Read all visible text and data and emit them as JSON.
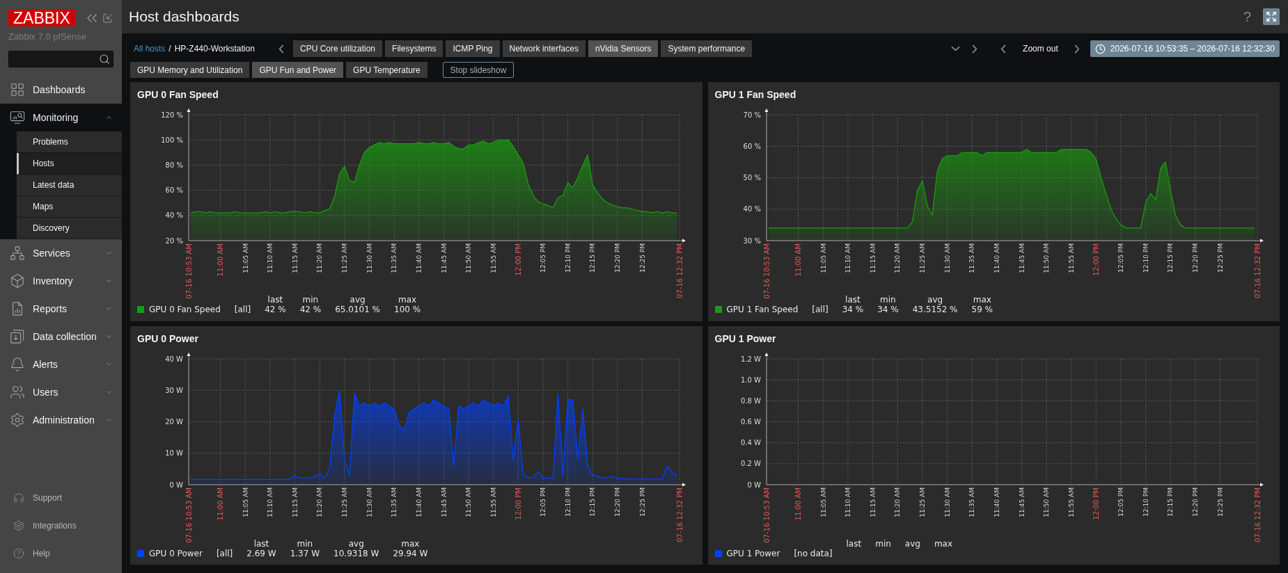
{
  "sidebar": {
    "logo": "ZABBIX",
    "server_name": "Zabbix 7.0 pfSense",
    "menu": [
      {
        "label": "Dashboards",
        "kind": "link"
      },
      {
        "label": "Monitoring",
        "kind": "group",
        "expanded": true,
        "children": [
          {
            "label": "Problems",
            "selected": false
          },
          {
            "label": "Hosts",
            "selected": true
          },
          {
            "label": "Latest data",
            "selected": false
          },
          {
            "label": "Maps",
            "selected": false
          },
          {
            "label": "Discovery",
            "selected": false
          }
        ]
      },
      {
        "label": "Services",
        "kind": "group",
        "expanded": false
      },
      {
        "label": "Inventory",
        "kind": "group",
        "expanded": false
      },
      {
        "label": "Reports",
        "kind": "group",
        "expanded": false
      },
      {
        "label": "Data collection",
        "kind": "group",
        "expanded": false
      },
      {
        "label": "Alerts",
        "kind": "group",
        "expanded": false
      },
      {
        "label": "Users",
        "kind": "group",
        "expanded": false
      },
      {
        "label": "Administration",
        "kind": "group",
        "expanded": false
      }
    ],
    "footer": [
      "Support",
      "Integrations",
      "Help"
    ]
  },
  "header": {
    "title": "Host dashboards",
    "help": "?"
  },
  "navigation": {
    "breadcrumbs": [
      {
        "label": "All hosts",
        "kind": "link"
      },
      {
        "label": "HP-Z440-Workstation",
        "kind": "current"
      }
    ],
    "separator": "/",
    "dashboards": [
      {
        "label": "CPU Core utilization",
        "selected": false
      },
      {
        "label": "Filesystems",
        "selected": false
      },
      {
        "label": "ICMP Ping",
        "selected": false
      },
      {
        "label": "Network interfaces",
        "selected": false
      },
      {
        "label": "nVidia Sensors",
        "selected": true
      },
      {
        "label": "System performance",
        "selected": false
      }
    ],
    "zoom_out": "Zoom out",
    "time_range": "2026-07-16 10:53:35 – 2026-07-16 12:32:30",
    "pages": [
      {
        "label": "GPU Memory and Utilization",
        "selected": false
      },
      {
        "label": "GPU Fun and Power",
        "selected": true
      },
      {
        "label": "GPU Temperature",
        "selected": false
      }
    ],
    "slideshow_button": "Stop slideshow"
  },
  "widgets": [
    {
      "title": "GPU 0 Fan Speed",
      "chart_data": {
        "type": "area",
        "grid": true,
        "x": [
          654,
          655,
          656,
          657,
          658,
          659,
          660,
          661,
          662,
          663,
          664,
          665,
          666,
          667,
          668,
          669,
          670,
          671,
          672,
          673,
          674,
          675,
          676,
          677,
          678,
          679,
          680,
          681,
          682,
          683,
          684,
          685,
          686,
          687,
          688,
          689,
          690,
          691,
          692,
          693,
          694,
          695,
          696,
          697,
          698,
          699,
          700,
          701,
          702,
          703,
          704,
          705,
          706,
          707,
          708,
          709,
          710,
          711,
          712,
          713,
          714,
          715,
          716,
          717,
          718,
          719,
          720,
          721,
          722,
          723,
          724,
          725,
          726,
          727,
          728,
          729,
          730,
          731,
          732,
          733,
          734,
          735,
          736,
          737,
          738,
          739,
          740,
          741,
          742,
          743,
          744,
          745,
          746,
          747,
          748,
          749,
          750,
          751,
          752
        ],
        "xlim": [
          653.6,
          752.5
        ],
        "ylim": [
          20,
          120
        ],
        "yticks": [
          {
            "value": 20,
            "label": "20 %"
          },
          {
            "value": 40,
            "label": "40 %"
          },
          {
            "value": 60,
            "label": "60 %"
          },
          {
            "value": 80,
            "label": "80 %"
          },
          {
            "value": 100,
            "label": "100 %"
          },
          {
            "value": 120,
            "label": "120 %"
          }
        ],
        "xticks": [
          {
            "value": 653.6,
            "label": "07-16 10:53 AM"
          },
          {
            "value": 660,
            "label": "11:00 AM"
          },
          {
            "value": 665,
            "label": "11:05 AM"
          },
          {
            "value": 670,
            "label": "11:10 AM"
          },
          {
            "value": 675,
            "label": "11:15 AM"
          },
          {
            "value": 680,
            "label": "11:20 AM"
          },
          {
            "value": 685,
            "label": "11:25 AM"
          },
          {
            "value": 690,
            "label": "11:30 AM"
          },
          {
            "value": 695,
            "label": "11:35 AM"
          },
          {
            "value": 700,
            "label": "11:40 AM"
          },
          {
            "value": 705,
            "label": "11:45 AM"
          },
          {
            "value": 710,
            "label": "11:50 AM"
          },
          {
            "value": 715,
            "label": "11:55 AM"
          },
          {
            "value": 720,
            "label": "12:00 PM"
          },
          {
            "value": 725,
            "label": "12:05 PM"
          },
          {
            "value": 730,
            "label": "12:10 PM"
          },
          {
            "value": 735,
            "label": "12:15 PM"
          },
          {
            "value": 740,
            "label": "12:20 PM"
          },
          {
            "value": 745,
            "label": "12:25 PM"
          },
          {
            "value": 752.5,
            "label": "07-16 12:32 PM"
          }
        ],
        "series": [
          {
            "name": "GPU 0 Fan Speed",
            "color": "#199c0d",
            "values": [
              42,
              43,
              43,
              42,
              43,
              42,
              42,
              42,
              42,
              43,
              42,
              42,
              42,
              42,
              42,
              43,
              42,
              43,
              42,
              42,
              43,
              43,
              43,
              42,
              43,
              42,
              42,
              44,
              45,
              55,
              73,
              79,
              68,
              66,
              80,
              90,
              94,
              96,
              98,
              97,
              98,
              97,
              97,
              97,
              97,
              97,
              98,
              97,
              97,
              98,
              97,
              97,
              98,
              95,
              93,
              93,
              96,
              96,
              98,
              99,
              97,
              98,
              100,
              100,
              100,
              95,
              88,
              82,
              65,
              56,
              51,
              49,
              48,
              46,
              54,
              56,
              66,
              62,
              70,
              80,
              88,
              64,
              58,
              53,
              50,
              48,
              47,
              46,
              46,
              45,
              44,
              43,
              43,
              42,
              43,
              42,
              43,
              42,
              42
            ]
          }
        ]
      },
      "legend": {
        "headers": [
          "last",
          "min",
          "avg",
          "max"
        ],
        "scope": "[all]",
        "values": [
          "42 %",
          "42 %",
          "65.0101 %",
          "100 %"
        ]
      }
    },
    {
      "title": "GPU 1 Fan Speed",
      "chart_data": {
        "type": "area",
        "grid": true,
        "x": [
          654,
          655,
          656,
          657,
          658,
          659,
          660,
          661,
          662,
          663,
          664,
          665,
          666,
          667,
          668,
          669,
          670,
          671,
          672,
          673,
          674,
          675,
          676,
          677,
          678,
          679,
          680,
          681,
          682,
          683,
          684,
          685,
          686,
          687,
          688,
          689,
          690,
          691,
          692,
          693,
          694,
          695,
          696,
          697,
          698,
          699,
          700,
          701,
          702,
          703,
          704,
          705,
          706,
          707,
          708,
          709,
          710,
          711,
          712,
          713,
          714,
          715,
          716,
          717,
          718,
          719,
          720,
          721,
          722,
          723,
          724,
          725,
          726,
          727,
          728,
          729,
          730,
          731,
          732,
          733,
          734,
          735,
          736,
          737,
          738,
          739,
          740,
          741,
          742,
          743,
          744,
          745,
          746,
          747,
          748,
          749,
          750,
          751,
          752
        ],
        "xlim": [
          653.6,
          752.5
        ],
        "ylim": [
          30,
          70
        ],
        "yticks": [
          {
            "value": 30,
            "label": "30 %"
          },
          {
            "value": 40,
            "label": "40 %"
          },
          {
            "value": 50,
            "label": "50 %"
          },
          {
            "value": 60,
            "label": "60 %"
          },
          {
            "value": 70,
            "label": "70 %"
          }
        ],
        "xticks": [
          {
            "value": 653.6,
            "label": "07-16 10:53 AM"
          },
          {
            "value": 660,
            "label": "11:00 AM"
          },
          {
            "value": 665,
            "label": "11:05 AM"
          },
          {
            "value": 670,
            "label": "11:10 AM"
          },
          {
            "value": 675,
            "label": "11:15 AM"
          },
          {
            "value": 680,
            "label": "11:20 AM"
          },
          {
            "value": 685,
            "label": "11:25 AM"
          },
          {
            "value": 690,
            "label": "11:30 AM"
          },
          {
            "value": 695,
            "label": "11:35 AM"
          },
          {
            "value": 700,
            "label": "11:40 AM"
          },
          {
            "value": 705,
            "label": "11:45 AM"
          },
          {
            "value": 710,
            "label": "11:50 AM"
          },
          {
            "value": 715,
            "label": "11:55 AM"
          },
          {
            "value": 720,
            "label": "12:00 PM"
          },
          {
            "value": 725,
            "label": "12:05 PM"
          },
          {
            "value": 730,
            "label": "12:10 PM"
          },
          {
            "value": 735,
            "label": "12:15 PM"
          },
          {
            "value": 740,
            "label": "12:20 PM"
          },
          {
            "value": 745,
            "label": "12:25 PM"
          },
          {
            "value": 752.5,
            "label": "07-16 12:32 PM"
          }
        ],
        "series": [
          {
            "name": "GPU 1 Fan Speed",
            "color": "#199c0d",
            "values": [
              34,
              34,
              34,
              34,
              34,
              34,
              34,
              34,
              34,
              34,
              34,
              34,
              34,
              34,
              34,
              34,
              34,
              34,
              34,
              34,
              34,
              34,
              34,
              34,
              34,
              34,
              34,
              34,
              34,
              36,
              46,
              49,
              41,
              38,
              52,
              56,
              57,
              57,
              57,
              58,
              58,
              58,
              58,
              57,
              58,
              58,
              58,
              58,
              58,
              58,
              58,
              58,
              59,
              58,
              58,
              58,
              58,
              58,
              58,
              59,
              59,
              59,
              59,
              59,
              59,
              58,
              56,
              50,
              45,
              40,
              37,
              35,
              34,
              34,
              34,
              34,
              42,
              45,
              43,
              53,
              55,
              46,
              38,
              35,
              34,
              34,
              34,
              34,
              34,
              34,
              34,
              34,
              34,
              34,
              34,
              34,
              34,
              34,
              34
            ]
          }
        ]
      },
      "legend": {
        "headers": [
          "last",
          "min",
          "avg",
          "max"
        ],
        "scope": "[all]",
        "values": [
          "34 %",
          "34 %",
          "43.5152 %",
          "59 %"
        ]
      }
    },
    {
      "title": "GPU 0 Power",
      "chart_data": {
        "type": "area",
        "grid": true,
        "x": [
          654,
          655,
          656,
          657,
          658,
          659,
          660,
          661,
          662,
          663,
          664,
          665,
          666,
          667,
          668,
          669,
          670,
          671,
          672,
          673,
          674,
          675,
          676,
          677,
          678,
          679,
          680,
          681,
          682,
          683,
          684,
          685,
          686,
          687,
          688,
          689,
          690,
          691,
          692,
          693,
          694,
          695,
          696,
          697,
          698,
          699,
          700,
          701,
          702,
          703,
          704,
          705,
          706,
          707,
          708,
          709,
          710,
          711,
          712,
          713,
          714,
          715,
          716,
          717,
          718,
          719,
          720,
          721,
          722,
          723,
          724,
          725,
          726,
          727,
          728,
          729,
          730,
          731,
          732,
          733,
          734,
          735,
          736,
          737,
          738,
          739,
          740,
          741,
          742,
          743,
          744,
          745,
          746,
          747,
          748,
          749,
          750,
          751,
          752
        ],
        "xlim": [
          653.6,
          752.5
        ],
        "ylim": [
          0,
          40
        ],
        "yticks": [
          {
            "value": 0,
            "label": "0 W"
          },
          {
            "value": 10,
            "label": "10 W"
          },
          {
            "value": 20,
            "label": "20 W"
          },
          {
            "value": 30,
            "label": "30 W"
          },
          {
            "value": 40,
            "label": "40 W"
          }
        ],
        "xticks": [
          {
            "value": 653.6,
            "label": "07-16 10:53 AM"
          },
          {
            "value": 660,
            "label": "11:00 AM"
          },
          {
            "value": 665,
            "label": "11:05 AM"
          },
          {
            "value": 670,
            "label": "11:10 AM"
          },
          {
            "value": 675,
            "label": "11:15 AM"
          },
          {
            "value": 680,
            "label": "11:20 AM"
          },
          {
            "value": 685,
            "label": "11:25 AM"
          },
          {
            "value": 690,
            "label": "11:30 AM"
          },
          {
            "value": 695,
            "label": "11:35 AM"
          },
          {
            "value": 700,
            "label": "11:40 AM"
          },
          {
            "value": 705,
            "label": "11:45 AM"
          },
          {
            "value": 710,
            "label": "11:50 AM"
          },
          {
            "value": 715,
            "label": "11:55 AM"
          },
          {
            "value": 720,
            "label": "12:00 PM"
          },
          {
            "value": 725,
            "label": "12:05 PM"
          },
          {
            "value": 730,
            "label": "12:10 PM"
          },
          {
            "value": 735,
            "label": "12:15 PM"
          },
          {
            "value": 740,
            "label": "12:20 PM"
          },
          {
            "value": 745,
            "label": "12:25 PM"
          },
          {
            "value": 752.5,
            "label": "07-16 12:32 PM"
          }
        ],
        "series": [
          {
            "name": "GPU 0 Power",
            "color": "#0040ff",
            "values": [
              1.7,
              1.7,
              1.7,
              1.7,
              1.7,
              1.7,
              1.7,
              1.7,
              1.7,
              1.7,
              1.7,
              1.7,
              1.7,
              1.7,
              1.7,
              1.7,
              1.7,
              1.7,
              1.7,
              1.7,
              1.7,
              2.9,
              2.1,
              2.3,
              2.0,
              2.4,
              3.5,
              2.0,
              5,
              22,
              30,
              8,
              3,
              29,
              25,
              26,
              25,
              26,
              25,
              26,
              25,
              24,
              19,
              17,
              23,
              24,
              25,
              26,
              25,
              27,
              26,
              25,
              24,
              6,
              25,
              24,
              25,
              26,
              25,
              27,
              26,
              25,
              26,
              25,
              28,
              8,
              21,
              3,
              2.3,
              2.2,
              4,
              2.1,
              2.1,
              2.1,
              29,
              3,
              27,
              27,
              8,
              24,
              6,
              3,
              2.5,
              2.2,
              2.1,
              2.7,
              2.1,
              2.0,
              1.8,
              1.8,
              1.8,
              1.8,
              1.8,
              1.8,
              1.8,
              1.8,
              6,
              4,
              2.7
            ]
          }
        ]
      },
      "legend": {
        "headers": [
          "last",
          "min",
          "avg",
          "max"
        ],
        "scope": "[all]",
        "values": [
          "2.69 W",
          "1.37 W",
          "10.9318 W",
          "29.94 W"
        ]
      }
    },
    {
      "title": "GPU 1 Power",
      "empty_chart": {
        "y_labels": [
          "1.2 W",
          "1.0 W",
          "0.8 W",
          "0.6 W",
          "0.4 W",
          "0.2 W",
          "0 W"
        ],
        "x_labels": [
          {
            "label": "07-16 10:53 AM",
            "kind": "major"
          },
          {
            "label": "11:00 AM",
            "kind": "major"
          },
          {
            "label": "11:05 AM",
            "kind": "minor"
          },
          {
            "label": "11:10 AM",
            "kind": "minor"
          },
          {
            "label": "11:15 AM",
            "kind": "minor"
          },
          {
            "label": "11:20 AM",
            "kind": "minor"
          },
          {
            "label": "11:25 AM",
            "kind": "minor"
          },
          {
            "label": "11:30 AM",
            "kind": "minor"
          },
          {
            "label": "11:35 AM",
            "kind": "minor"
          },
          {
            "label": "11:40 AM",
            "kind": "minor"
          },
          {
            "label": "11:45 AM",
            "kind": "minor"
          },
          {
            "label": "11:50 AM",
            "kind": "minor"
          },
          {
            "label": "11:55 AM",
            "kind": "minor"
          },
          {
            "label": "12:00 PM",
            "kind": "major"
          },
          {
            "label": "12:05 PM",
            "kind": "minor"
          },
          {
            "label": "12:10 PM",
            "kind": "minor"
          },
          {
            "label": "12:15 PM",
            "kind": "minor"
          },
          {
            "label": "12:20 PM",
            "kind": "minor"
          },
          {
            "label": "12:25 PM",
            "kind": "minor"
          },
          {
            "label": "07-16 12:32 PM",
            "kind": "major"
          }
        ]
      },
      "legend": {
        "headers": [
          "last",
          "min",
          "avg",
          "max"
        ],
        "name": "GPU 1 Power",
        "color": "#0040ff",
        "scope": "[no data]"
      }
    }
  ]
}
